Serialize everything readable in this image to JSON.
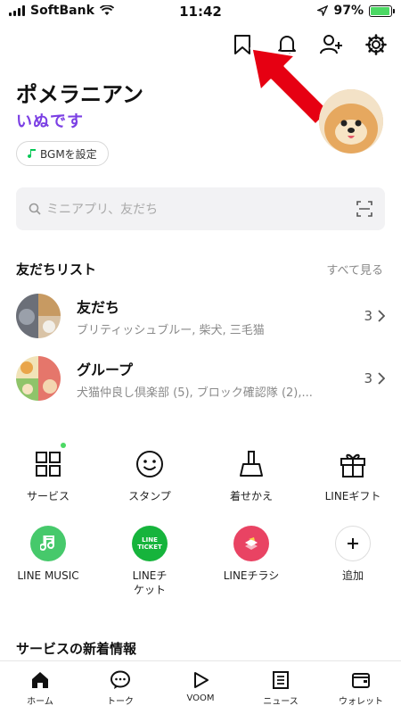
{
  "status_bar": {
    "carrier": "SoftBank",
    "time": "11:42",
    "battery": "97%",
    "battery_level": 0.97
  },
  "profile": {
    "name": "ポメラニアン",
    "status_message": "いぬです",
    "bgm_label": "BGMを設定"
  },
  "search": {
    "placeholder": "ミニアプリ、友だち"
  },
  "friends": {
    "title": "友だちリスト",
    "see_all": "すべて見る",
    "rows": [
      {
        "name": "友だち",
        "sub": "ブリティッシュブルー, 柴犬, 三毛猫",
        "count": "3"
      },
      {
        "name": "グループ",
        "sub": "犬猫仲良し倶楽部 (5), ブロック確認隊 (2),...",
        "count": "3"
      }
    ]
  },
  "services": [
    {
      "label": "サービス"
    },
    {
      "label": "スタンプ"
    },
    {
      "label": "着せかえ"
    },
    {
      "label": "LINEギフト"
    },
    {
      "label": "LINE MUSIC"
    },
    {
      "label": "LINEチ\nケット"
    },
    {
      "label": "LINEチラシ"
    },
    {
      "label": "追加"
    }
  ],
  "ticket_badge": {
    "line1": "LINE",
    "line2": "TICKET"
  },
  "news": {
    "title": "サービスの新着情報"
  },
  "nav": [
    {
      "label": "ホーム",
      "active": true
    },
    {
      "label": "トーク"
    },
    {
      "label": "VOOM"
    },
    {
      "label": "ニュース"
    },
    {
      "label": "ウォレット"
    }
  ],
  "colors": {
    "line_green": "#06c755",
    "arrow_red": "#e60012",
    "status_purple": "#7b3fe4"
  }
}
